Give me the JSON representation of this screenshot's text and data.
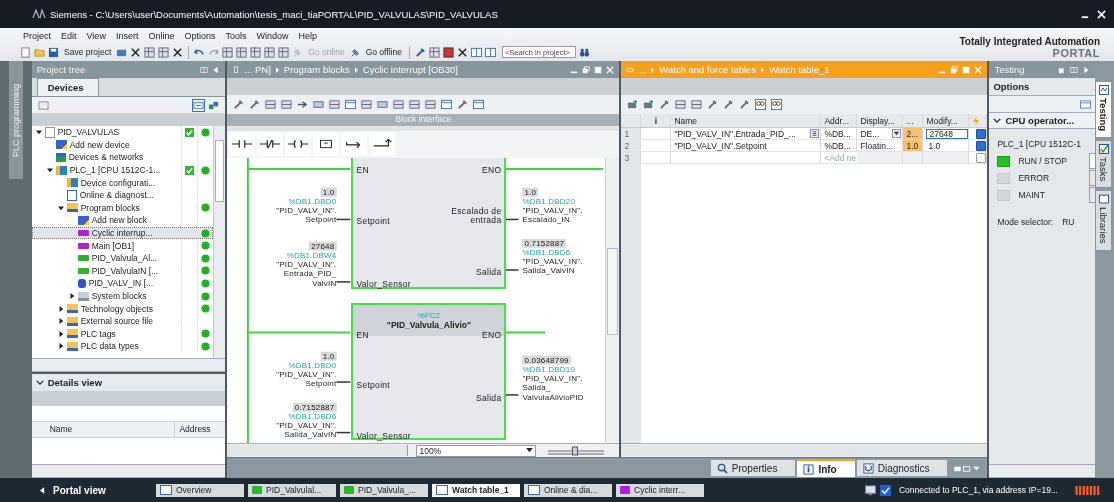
{
  "window": {
    "title": "Siemens  -  C:\\Users\\user\\Documents\\Automation\\tesis_maci_tiaPORTAL\\PID_VALVULAS\\PID_VALVULAS"
  },
  "menu": [
    "Project",
    "Edit",
    "View",
    "Insert",
    "Online",
    "Options",
    "Tools",
    "Window",
    "Help"
  ],
  "toolbar": {
    "buttons": [
      {
        "label": "Save project",
        "disabled": false
      },
      {
        "label": "Go online",
        "disabled": true
      },
      {
        "label": "Go offline",
        "disabled": false
      }
    ],
    "search": {
      "placeholder": "<Search in project>"
    }
  },
  "brand": {
    "line1": "Totally Integrated Automation",
    "line2": "PORTAL"
  },
  "side_tab": "PLC programming",
  "project_tree": {
    "title": "Project tree",
    "tab": "Devices",
    "items": [
      {
        "label": "PID_VALVULAS",
        "kind": "project",
        "expanded": true,
        "selected": false,
        "check": true,
        "dot": true,
        "children": [
          {
            "label": "Add new device",
            "kind": "add",
            "selected": false,
            "check": false,
            "dot": false
          },
          {
            "label": "Devices & networks",
            "kind": "network",
            "selected": false,
            "check": false,
            "dot": false
          },
          {
            "label": "PLC_1 [CPU 1512C-1...",
            "kind": "plc",
            "expanded": true,
            "selected": false,
            "check": true,
            "dot": true,
            "children": [
              {
                "label": "Device configurati...",
                "kind": "config",
                "selected": false,
                "check": false,
                "dot": false
              },
              {
                "label": "Online & diagnost...",
                "kind": "diag",
                "selected": false,
                "check": false,
                "dot": false
              },
              {
                "label": "Program blocks",
                "kind": "folder",
                "expanded": true,
                "selected": false,
                "check": false,
                "dot": true,
                "children": [
                  {
                    "label": "Add new block",
                    "kind": "add",
                    "selected": false,
                    "check": false,
                    "dot": false
                  },
                  {
                    "label": "Cyclic interrup...",
                    "kind": "ob",
                    "selected": true,
                    "check": false,
                    "dot": true
                  },
                  {
                    "label": "Main [OB1]",
                    "kind": "ob",
                    "selected": false,
                    "check": false,
                    "dot": true
                  },
                  {
                    "label": "PID_Valvula_Al...",
                    "kind": "fc",
                    "selected": false,
                    "check": false,
                    "dot": true
                  },
                  {
                    "label": "PID_ValvulaIN [...",
                    "kind": "fc",
                    "selected": false,
                    "check": false,
                    "dot": true
                  },
                  {
                    "label": "PID_VALV_IN [...",
                    "kind": "db",
                    "selected": false,
                    "check": false,
                    "dot": true
                  },
                  {
                    "label": "System blocks",
                    "kind": "sysfolder",
                    "expanded": false,
                    "selected": false,
                    "check": false,
                    "dot": true
                  }
                ]
              },
              {
                "label": "Technology objects",
                "kind": "tech",
                "expanded": false,
                "selected": false,
                "check": false,
                "dot": true
              },
              {
                "label": "External source file",
                "kind": "ext",
                "expanded": false,
                "selected": false,
                "check": false,
                "dot": false
              },
              {
                "label": "PLC tags",
                "kind": "tags",
                "expanded": false,
                "selected": false,
                "check": false,
                "dot": true
              },
              {
                "label": "PLC data types",
                "kind": "types",
                "expanded": false,
                "selected": false,
                "check": false,
                "dot": true
              }
            ]
          }
        ]
      }
    ]
  },
  "details_view": {
    "title": "Details view",
    "expanded": true,
    "columns": [
      "Name",
      "Address"
    ]
  },
  "editor": {
    "breadcrumb": [
      "... PN]",
      "Program blocks",
      "Cyclic interrupt [OB30]"
    ],
    "block_interface": "Block interface",
    "zoom": "100%",
    "zoom_slider": {
      "level": 0.48
    },
    "blocks": [
      {
        "inputs": [
          {
            "pin": "EN"
          },
          {
            "pin": "Setpoint",
            "operand": {
              "value": "1.0",
              "address": "%DB1.DBD0",
              "tag": [
                "\"PID_VALV_IN\".",
                "Setpoint"
              ]
            }
          },
          {
            "pin": "Valor_Sensor",
            "operand": {
              "value": "27648",
              "address": "%DB1.DBW4",
              "tag": [
                "\"PID_VALV_IN\".",
                "Entrada_PID_",
                "ValvIN"
              ]
            }
          }
        ],
        "outputs": [
          {
            "pin": "ENO"
          },
          {
            "pin": "Escalado de entrada",
            "operand": {
              "value": "1.0",
              "address": "%DB1.DBD20",
              "tag": [
                "\"PID_VALV_IN\".",
                "Escalado_IN"
              ]
            }
          },
          {
            "pin": "Salida",
            "operand": {
              "value": "0.7152887",
              "address": "%DB1.DBD6",
              "tag": [
                "\"PID_VALV_IN\".",
                "Salida_ValvIN"
              ]
            }
          }
        ]
      },
      {
        "number": "%FC2",
        "name": "\"PID_Valvula_Alivio\"",
        "inputs": [
          {
            "pin": "EN"
          },
          {
            "pin": "Setpoint",
            "operand": {
              "value": "1.0",
              "address": "%DB1.DBD0",
              "tag": [
                "\"PID_VALV_IN\".",
                "Setpoint"
              ]
            }
          },
          {
            "pin": "Valor_Sensor",
            "operand": {
              "value": "0.7152887",
              "address": "%DB1.DBD6",
              "tag": [
                "\"PID_VALV_IN\".",
                "Salida_ValvIN"
              ]
            }
          }
        ],
        "outputs": [
          {
            "pin": "ENO"
          },
          {
            "pin": "Salida",
            "operand": {
              "value": "0.03648799",
              "address": "%DB1.DBD10",
              "tag": [
                "\"PID_VALV_IN\".",
                "Salida_",
                "ValvulaAlivioPID"
              ]
            }
          }
        ]
      }
    ]
  },
  "watch": {
    "breadcrumb": [
      "...",
      "Watch and force tables",
      "Watch table_1"
    ],
    "active": true,
    "columns": [
      "",
      "i",
      "Name",
      "Addr...",
      "Display...",
      "...",
      "Modify..."
    ],
    "rows": [
      {
        "kind": "tag",
        "no": "1",
        "name": "\"PID_VALV_IN\".Entrada_PID_...",
        "address": "%DB...",
        "display": "DE...",
        "monitor": "2...",
        "modify": "27648",
        "checked": true
      },
      {
        "kind": "tag",
        "no": "2",
        "name": "\"PID_VALV_IN\".Setpoint",
        "address": "%DB...",
        "display": "Floatin...",
        "monitor": "1.0",
        "modify": "1.0",
        "checked": true
      },
      {
        "kind": "add",
        "no": "3",
        "placeholder": "<Add ne",
        "checked": false
      }
    ]
  },
  "testing": {
    "title": "Testing",
    "options": "Options",
    "section": "CPU operator...",
    "plc": "PLC_1 [CPU 1512C-1",
    "leds": [
      {
        "label": "RUN / STOP",
        "on": true
      },
      {
        "label": "ERROR",
        "on": false
      },
      {
        "label": "MAINT",
        "on": false
      }
    ],
    "mode_label": "Mode selector:",
    "mode_value": "RU"
  },
  "right_tabs": [
    {
      "label": "Testing",
      "selected": true
    },
    {
      "label": "Tasks",
      "selected": false
    },
    {
      "label": "Libraries",
      "selected": false
    }
  ],
  "info_tabs": [
    {
      "label": "Properties",
      "selected": false
    },
    {
      "label": "Info",
      "selected": true
    },
    {
      "label": "Diagnostics",
      "selected": false
    }
  ],
  "taskbar": {
    "portal_view": "Portal view",
    "items": [
      {
        "label": "Overview",
        "kind": "overview",
        "selected": false
      },
      {
        "label": "PID_Valvulal...",
        "kind": "fc",
        "selected": false
      },
      {
        "label": "PID_Valvula_...",
        "kind": "fc",
        "selected": false
      },
      {
        "label": "Watch table_1",
        "kind": "watch",
        "selected": true
      },
      {
        "label": "Online & dia...",
        "kind": "diag",
        "selected": false
      },
      {
        "label": "Cyclic interr...",
        "kind": "ob",
        "selected": false
      }
    ],
    "status": "Connected to PLC_1, via address IP=19..."
  }
}
